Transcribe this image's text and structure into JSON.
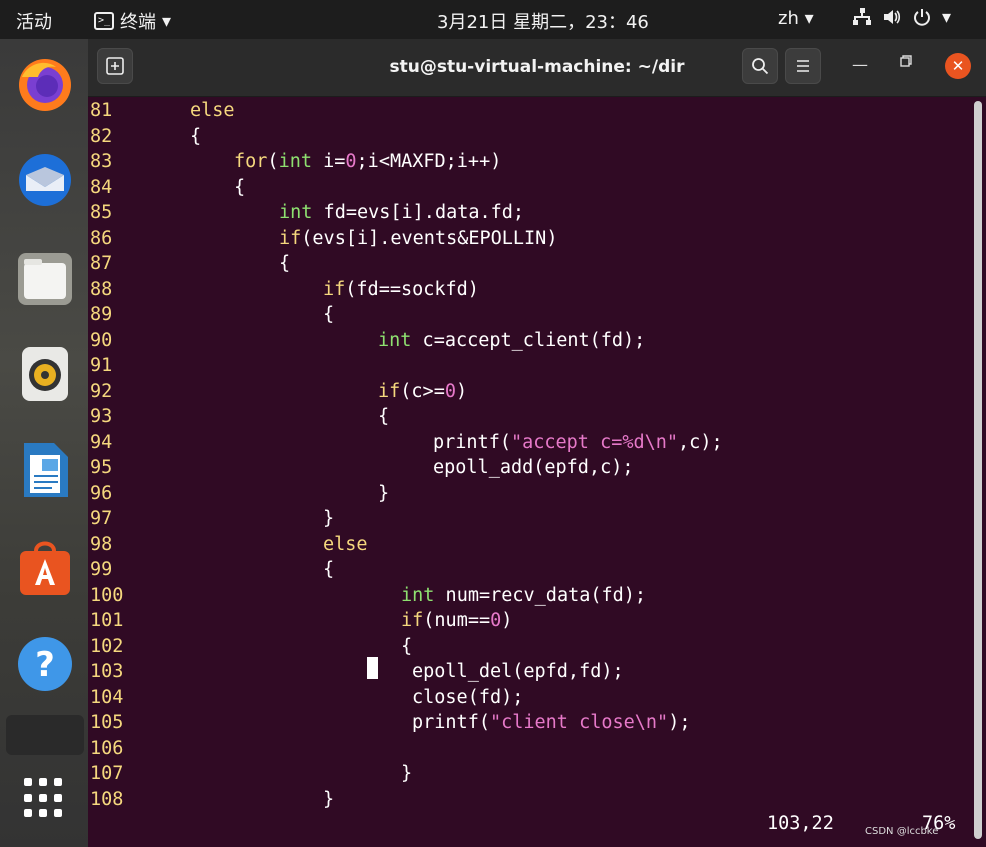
{
  "topbar": {
    "activities": "活动",
    "app_name": "终端",
    "clock": "3月21日 星期二，23：46",
    "lang": "zh",
    "icons": [
      "network-icon",
      "volume-icon",
      "power-icon",
      "chevron-down-icon"
    ]
  },
  "dock": {
    "items": [
      "firefox",
      "thunderbird",
      "files",
      "rhythmbox",
      "libreoffice-writer",
      "software-center",
      "help"
    ]
  },
  "window": {
    "title": "stu@stu-virtual-machine: ~/dir"
  },
  "code": {
    "lines": [
      {
        "n": "81",
        "text": "else"
      },
      {
        "n": "82",
        "text": "{"
      },
      {
        "n": "83",
        "text": "for(int i=0;i<MAXFD;i++)"
      },
      {
        "n": "84",
        "text": "{"
      },
      {
        "n": "85",
        "text": "int fd=evs[i].data.fd;"
      },
      {
        "n": "86",
        "text": "if(evs[i].events&EPOLLIN)"
      },
      {
        "n": "87",
        "text": "{"
      },
      {
        "n": "88",
        "text": "if(fd==sockfd)"
      },
      {
        "n": "89",
        "text": "{"
      },
      {
        "n": "90",
        "text": "int c=accept_client(fd);"
      },
      {
        "n": "91",
        "text": ""
      },
      {
        "n": "92",
        "text": "if(c>=0)"
      },
      {
        "n": "93",
        "text": "{"
      },
      {
        "n": "94",
        "text": "printf(\"accept c=%d\\n\",c);"
      },
      {
        "n": "95",
        "text": "epoll_add(epfd,c);"
      },
      {
        "n": "96",
        "text": "}"
      },
      {
        "n": "97",
        "text": "}"
      },
      {
        "n": "98",
        "text": "else"
      },
      {
        "n": "99",
        "text": "{"
      },
      {
        "n": "100",
        "text": "int num=recv_data(fd);"
      },
      {
        "n": "101",
        "text": "if(num==0)"
      },
      {
        "n": "102",
        "text": "{"
      },
      {
        "n": "103",
        "text": "epoll_del(epfd,fd);"
      },
      {
        "n": "104",
        "text": "close(fd);"
      },
      {
        "n": "105",
        "text": "printf(\"client close\\n\");"
      },
      {
        "n": "106",
        "text": ""
      },
      {
        "n": "107",
        "text": "}"
      },
      {
        "n": "108",
        "text": "}"
      }
    ]
  },
  "status": {
    "position": "103,22",
    "percent": "76%"
  },
  "watermark": "CSDN @lccbke"
}
